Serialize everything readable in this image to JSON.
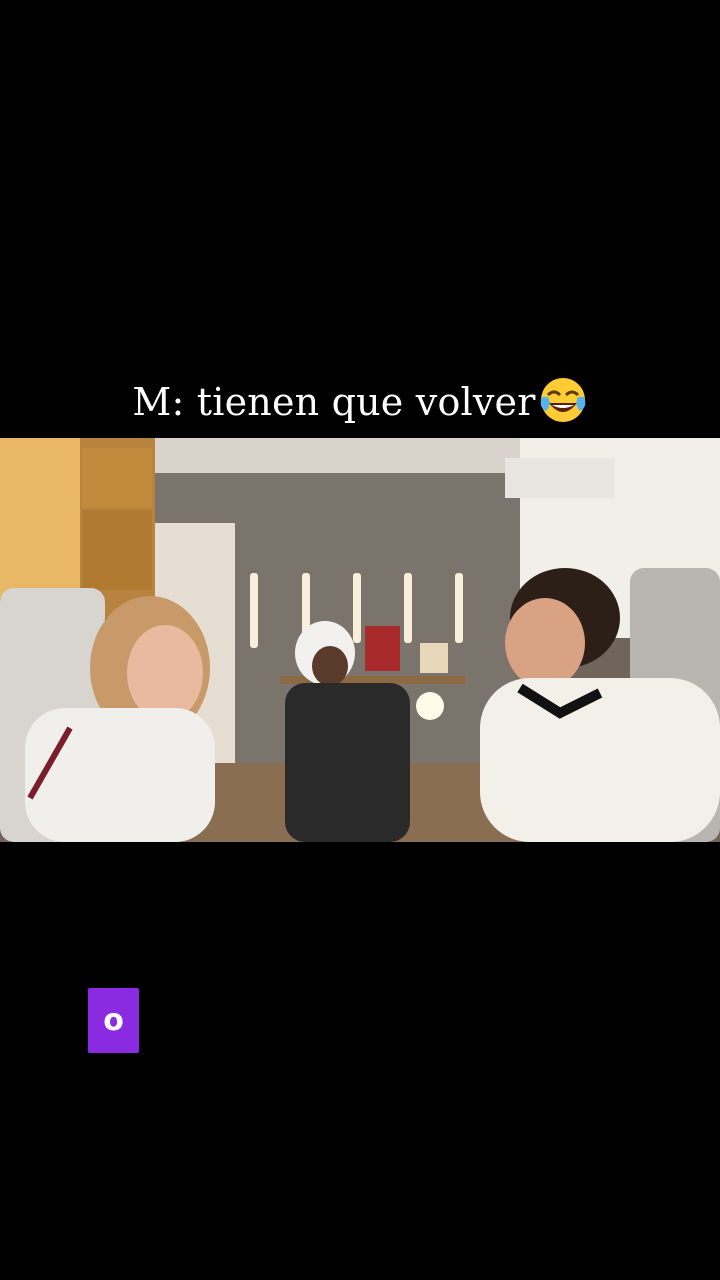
{
  "caption": {
    "text": "M: tienen que volver",
    "emoji_icon": "tears-of-joy-emoji-icon"
  },
  "video": {
    "description_icon": "video-frame"
  },
  "badge": {
    "letter": "o",
    "color": "#8a2be2"
  }
}
